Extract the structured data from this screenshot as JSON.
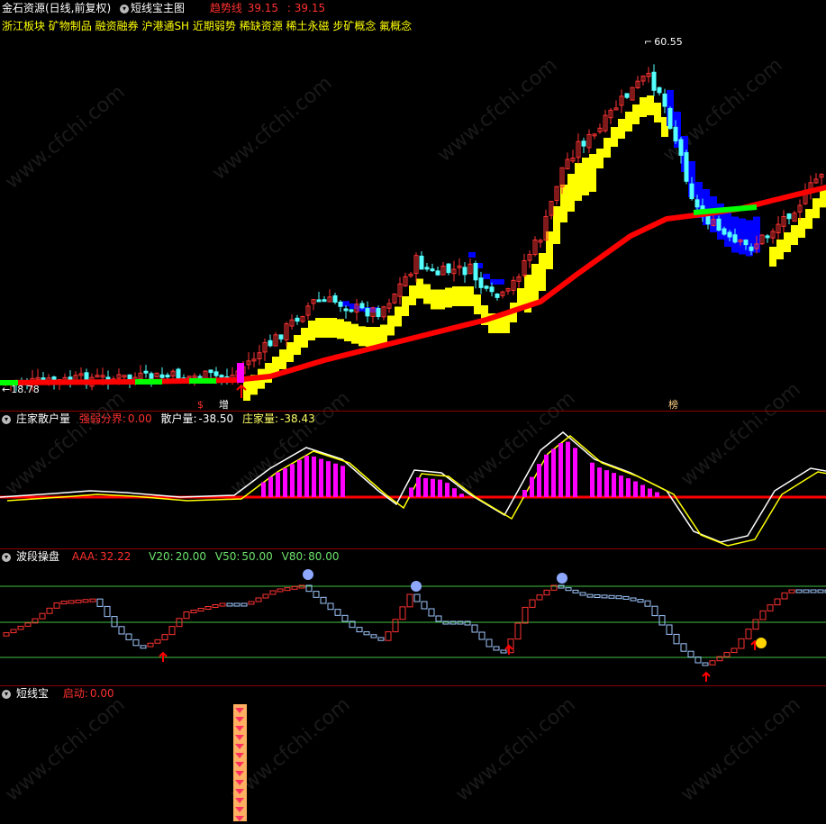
{
  "main": {
    "title": "金石资源(日线,前复权)",
    "indicator": "短线宝主图",
    "trend_label": "趋势线",
    "trend_value": "39.15",
    "trend_value2": ": 39.15",
    "concepts": "浙江板块 矿物制品 融资融券 沪港通SH 近期弱势  稀缺资源 稀土永磁 步矿概念 氟概念",
    "high_label": "60.55",
    "low_label": "18.78",
    "marker_s": "$",
    "marker_zeng": "增",
    "marker_bang": "榜"
  },
  "panel2": {
    "title": "庄家散户量",
    "k1": "强弱分界:",
    "v1": "0.00",
    "k2": "散户量:",
    "v2": "-38.50",
    "k3": "庄家量:",
    "v3": "-38.43"
  },
  "panel3": {
    "title": "波段操盘",
    "k1": "AAA:",
    "v1": "32.22",
    "k2": "V20:",
    "v2": "20.00",
    "k3": "V50:",
    "v3": "50.00",
    "k4": "V80:",
    "v4": "80.00"
  },
  "panel4": {
    "title": "短线宝",
    "k1": "启动:",
    "v1": "0.00"
  },
  "watermark": "www.cfchi.com",
  "colors": {
    "up": "#ff3232",
    "down": "#54ffff",
    "yellow": "#ffff00",
    "blue": "#0000ff",
    "green": "#00ff00",
    "magenta": "#ff00ff",
    "red_line": "#ff0000"
  }
}
